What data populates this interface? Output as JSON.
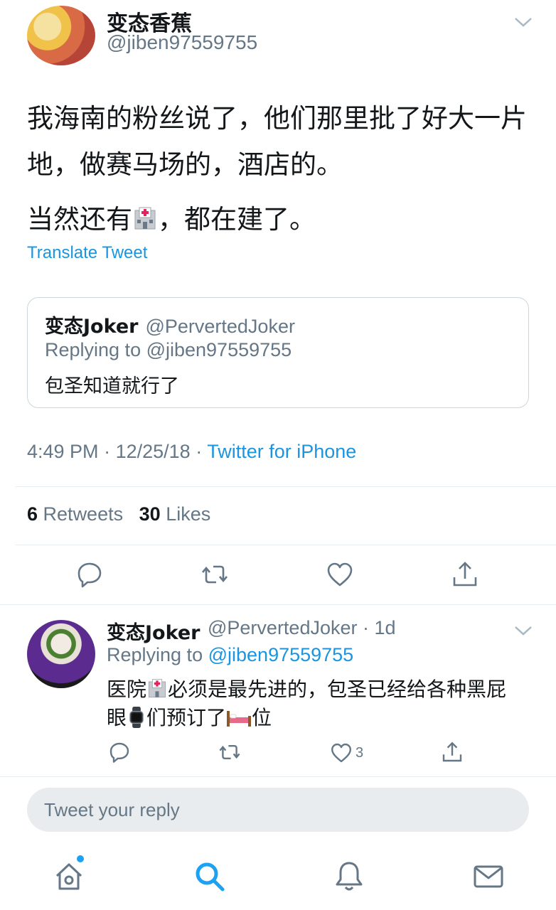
{
  "tweet": {
    "author": {
      "display_name": "变态香蕉",
      "handle": "@jiben97559755"
    },
    "text_line_1": "我海南的粉丝说了，他们那里批了好大一片地，做赛马场的，酒店的。",
    "text_line_2_before_emoji": "当然还有",
    "text_line_2_after_emoji": "，都在建了。",
    "translate_label": "Translate Tweet",
    "quoted": {
      "display_name": "变态Joker",
      "handle": "@PervertedJoker",
      "replying_to": "Replying to @jiben97559755",
      "text": "包圣知道就行了"
    },
    "meta": {
      "time": "4:49 PM",
      "date": "12/25/18",
      "separator": "·",
      "source": "Twitter for iPhone"
    },
    "stats": {
      "retweet_count": "6",
      "retweet_label": "Retweets",
      "like_count": "30",
      "like_label": "Likes"
    }
  },
  "reply": {
    "display_name": "变态Joker",
    "handle_time": "@PervertedJoker · 1d",
    "replying_prefix": "Replying to",
    "replying_handle": "@jiben97559755",
    "text_line_1_a": "医院",
    "text_line_1_b": "必须是最先进的，包圣已经给各种黑屁",
    "text_line_2_a": "眼",
    "text_line_2_b": "们预订了",
    "text_line_2_c": "位",
    "like_count": "3"
  },
  "compose": {
    "placeholder": "Tweet your reply"
  },
  "icons": {
    "hospital": "hospital-emoji-icon",
    "watch": "watch-emoji-icon",
    "bed": "bed-emoji-icon",
    "reply": "reply-icon",
    "retweet": "retweet-icon",
    "like": "heart-icon",
    "share": "share-icon",
    "home": "home-icon",
    "search": "search-icon",
    "notifications": "bell-icon",
    "messages": "mail-icon"
  },
  "colors": {
    "accent": "#1da1f2",
    "link": "#1b95e0",
    "muted": "#657786",
    "text": "#14171a"
  }
}
